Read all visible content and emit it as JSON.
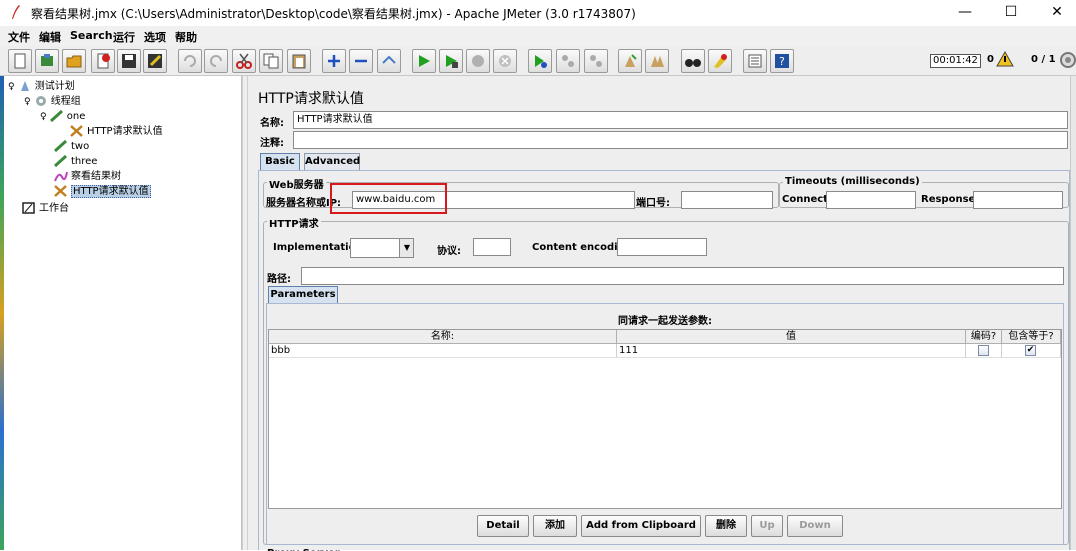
{
  "window": {
    "title": "察看结果树.jmx (C:\\Users\\Administrator\\Desktop\\code\\察看结果树.jmx) - Apache JMeter (3.0 r1743807)",
    "minimize": "—",
    "maximize": "☐",
    "close": "✕"
  },
  "menu": [
    "文件",
    "编辑",
    "Search",
    "运行",
    "选项",
    "帮助"
  ],
  "toolbar": {
    "timer": "00:01:42",
    "warnings": "0",
    "threads": "0 / 1"
  },
  "tree": {
    "nodes": [
      {
        "label": "测试计划",
        "icon": "test-plan-icon"
      },
      {
        "label": "线程组",
        "icon": "thread-group-gear-icon"
      },
      {
        "label": "one",
        "icon": "sampler-pen-icon"
      },
      {
        "label": "HTTP请求默认值",
        "icon": "config-tools-icon"
      },
      {
        "label": "two",
        "icon": "sampler-pen-icon"
      },
      {
        "label": "three",
        "icon": "sampler-pen-icon"
      },
      {
        "label": "察看结果树",
        "icon": "listener-chart-icon"
      },
      {
        "label": "HTTP请求默认值",
        "icon": "config-tools-icon"
      },
      {
        "label": "工作台",
        "icon": "workbench-icon"
      }
    ]
  },
  "panel": {
    "title": "HTTP请求默认值",
    "name_label": "名称:",
    "name_value": "HTTP请求默认值",
    "comment_label": "注释:",
    "comment_value": "",
    "tabs": [
      "Basic",
      "Advanced"
    ],
    "web_server": {
      "group_title": "Web服务器",
      "server_label": "服务器名称或IP:",
      "server_value": "www.baidu.com",
      "port_label": "端口号:",
      "port_value": ""
    },
    "timeouts": {
      "group_title": "Timeouts (milliseconds)",
      "connect_label": "Connect:",
      "connect_value": "",
      "response_label": "Response:",
      "response_value": ""
    },
    "http_request": {
      "group_title": "HTTP请求",
      "implementation_label": "Implementation:",
      "implementation_value": "",
      "protocol_label": "协议:",
      "protocol_value": "",
      "encoding_label": "Content encoding:",
      "encoding_value": "",
      "path_label": "路径:",
      "path_value": ""
    },
    "parameters": {
      "tab": "Parameters",
      "table_title": "同请求一起发送参数:",
      "columns": [
        "名称:",
        "值",
        "编码?",
        "包含等于?"
      ],
      "rows": [
        {
          "name": "bbb",
          "value": "111",
          "encode": false,
          "include_equals": true
        }
      ]
    },
    "buttons": [
      "Detail",
      "添加",
      "Add from Clipboard",
      "删除",
      "Up",
      "Down"
    ],
    "bottom_cut_label": "Proxy Server"
  }
}
